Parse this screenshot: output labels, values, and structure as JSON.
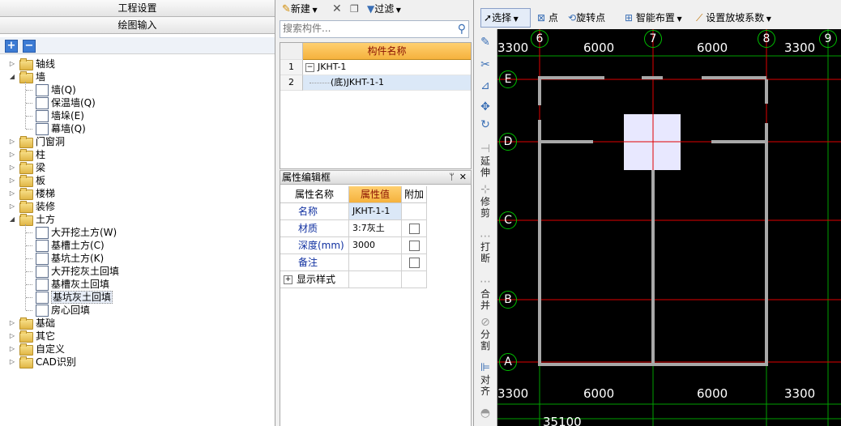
{
  "left": {
    "header1": "工程设置",
    "header2": "绘图输入",
    "tree": [
      {
        "label": "轴线",
        "level": 0,
        "type": "folder",
        "expanded": false
      },
      {
        "label": "墙",
        "level": 0,
        "type": "folder",
        "expanded": true
      },
      {
        "label": "墙(Q)",
        "level": 1,
        "type": "leaf"
      },
      {
        "label": "保温墙(Q)",
        "level": 1,
        "type": "leaf"
      },
      {
        "label": "墙垛(E)",
        "level": 1,
        "type": "leaf"
      },
      {
        "label": "幕墙(Q)",
        "level": 1,
        "type": "leaf"
      },
      {
        "label": "门窗洞",
        "level": 0,
        "type": "folder",
        "expanded": false
      },
      {
        "label": "柱",
        "level": 0,
        "type": "folder",
        "expanded": false
      },
      {
        "label": "梁",
        "level": 0,
        "type": "folder",
        "expanded": false
      },
      {
        "label": "板",
        "level": 0,
        "type": "folder",
        "expanded": false
      },
      {
        "label": "楼梯",
        "level": 0,
        "type": "folder",
        "expanded": false
      },
      {
        "label": "装修",
        "level": 0,
        "type": "folder",
        "expanded": false
      },
      {
        "label": "土方",
        "level": 0,
        "type": "folder",
        "expanded": true
      },
      {
        "label": "大开挖土方(W)",
        "level": 1,
        "type": "leaf"
      },
      {
        "label": "基槽土方(C)",
        "level": 1,
        "type": "leaf"
      },
      {
        "label": "基坑土方(K)",
        "level": 1,
        "type": "leaf"
      },
      {
        "label": "大开挖灰土回填",
        "level": 1,
        "type": "leaf"
      },
      {
        "label": "基槽灰土回填",
        "level": 1,
        "type": "leaf"
      },
      {
        "label": "基坑灰土回填",
        "level": 1,
        "type": "leaf",
        "selected": true
      },
      {
        "label": "房心回填",
        "level": 1,
        "type": "leaf"
      },
      {
        "label": "基础",
        "level": 0,
        "type": "folder",
        "expanded": false
      },
      {
        "label": "其它",
        "level": 0,
        "type": "folder",
        "expanded": false
      },
      {
        "label": "自定义",
        "level": 0,
        "type": "folder",
        "expanded": false
      },
      {
        "label": "CAD识别",
        "level": 0,
        "type": "folder",
        "expanded": false
      }
    ]
  },
  "mid": {
    "toolbar": {
      "new_label": "新建",
      "filter_label": "过滤"
    },
    "search_placeholder": "搜索构件...",
    "comp_table": {
      "header": "构件名称",
      "rows": [
        {
          "num": "1",
          "name": "JKHT-1"
        },
        {
          "num": "2",
          "name": "(底)JKHT-1-1"
        }
      ]
    },
    "prop_title": "属性编辑框",
    "prop_table": {
      "headers": [
        "属性名称",
        "属性值",
        "附加"
      ],
      "rows": [
        {
          "name": "名称",
          "value": "JKHT-1-1",
          "checkbox": false
        },
        {
          "name": "材质",
          "value": "3:7灰土",
          "checkbox": true
        },
        {
          "name": "深度(mm)",
          "value": "3000",
          "checkbox": true
        },
        {
          "name": "备注",
          "value": "",
          "checkbox": true
        },
        {
          "name": "显示样式",
          "value": "",
          "checkbox": false,
          "expandable": true
        }
      ]
    }
  },
  "right": {
    "toolbar": {
      "select_label": "选择",
      "point_label": "点",
      "rotate_label": "旋转点",
      "smart_label": "智能布置",
      "slope_label": "设置放坡系数"
    },
    "vtools": [
      "延伸",
      "修剪",
      "打断",
      "合并",
      "分割",
      "对齐"
    ],
    "canvas": {
      "axis_top": [
        "6",
        "7",
        "8",
        "9"
      ],
      "axis_left": [
        "E",
        "D",
        "C",
        "B",
        "A"
      ],
      "dims_top": [
        "3300",
        "6000",
        "6000",
        "3300"
      ],
      "dims_bottom": [
        "3300",
        "6000",
        "6000",
        "3300"
      ],
      "total_bottom": "35100"
    }
  }
}
